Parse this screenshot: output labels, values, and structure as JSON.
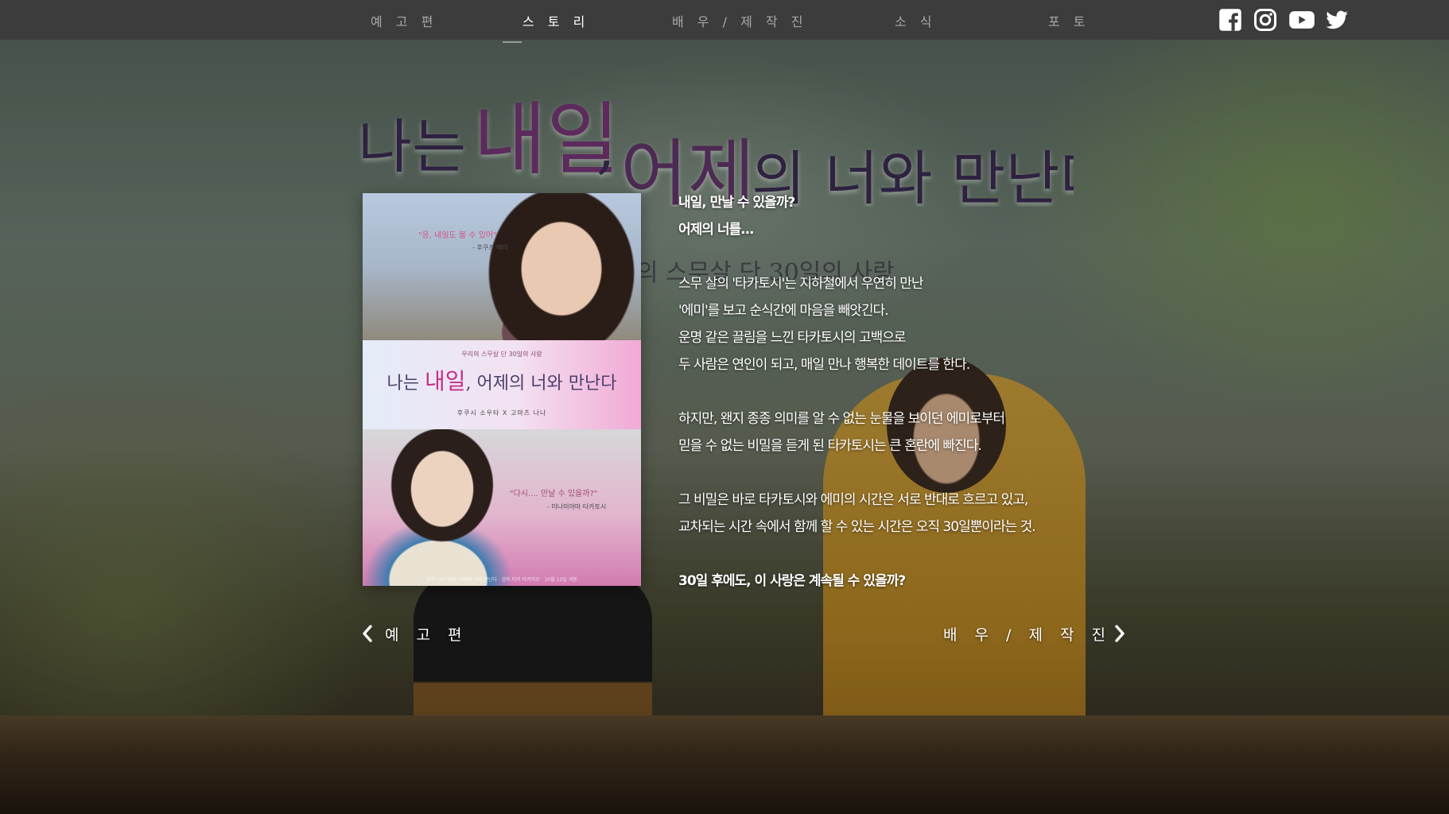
{
  "nav": {
    "items": [
      {
        "label": "예 고 편",
        "active": false
      },
      {
        "label": "스 토 리",
        "active": true
      },
      {
        "label": "배 우 / 제 작 진",
        "active": false
      },
      {
        "label": "소 식",
        "active": false
      },
      {
        "label": "포 토",
        "active": false
      }
    ],
    "social": [
      "facebook-icon",
      "instagram-icon",
      "youtube-icon",
      "twitter-icon"
    ]
  },
  "title": {
    "part1": "나는 ",
    "part2": "내일",
    "part3": ",",
    "part4": "어제",
    "part5": "의 너와 만난다",
    "ghost": "의 스무살 단 30일의 사랑"
  },
  "poster": {
    "quote_top": "\"응, 내일도 볼 수 있어\"",
    "credit_top": "- 후쿠즈 에미",
    "tagline": "우리의 스무살 단 30일의 사랑",
    "title_a": "나는 ",
    "title_b": "내일",
    "title_c": ", 어제의 너와 만난다",
    "cast": "후쿠시 소우타   X   고마츠 나나",
    "quote_bottom": "\"다시.... 만날 수 있을까?\"",
    "credit_bottom": "- 미나미야마 타카토시",
    "footer": "원작 나는 내일, 어제의 너와 만난다 · 감독 미키 타카히로 · 10월 12일 개봉"
  },
  "story": {
    "lines": [
      {
        "text": "내일, 만날 수 있을까?",
        "bold": true
      },
      {
        "text": "어제의 너를...",
        "bold": true
      },
      {
        "text": "",
        "bold": false
      },
      {
        "text": "스무 살의 '타카토시'는 지하철에서 우연히 만난",
        "bold": false
      },
      {
        "text": "'에미'를 보고 순식간에 마음을 빼앗긴다.",
        "bold": false
      },
      {
        "text": "운명 같은 끌림을 느낀 타카토시의 고백으로",
        "bold": false
      },
      {
        "text": "두 사람은 연인이 되고, 매일 만나 행복한 데이트를 한다.",
        "bold": false
      },
      {
        "text": "",
        "bold": false
      },
      {
        "text": "하지만, 왠지 종종 의미를 알 수 없는 눈물을 보이던 에미로부터",
        "bold": false
      },
      {
        "text": "믿을 수 없는 비밀을 듣게 된 타카토시는 큰 혼란에 빠진다.",
        "bold": false
      },
      {
        "text": "",
        "bold": false
      },
      {
        "text": "그 비밀은 바로 타카토시와 에미의 시간은 서로 반대로 흐르고 있고,",
        "bold": false
      },
      {
        "text": "교차되는 시간 속에서 함께 할 수 있는 시간은 오직 30일뿐이라는 것.",
        "bold": false
      },
      {
        "text": "",
        "bold": false
      },
      {
        "text": "30일 후에도, 이 사랑은 계속될 수 있을까?",
        "bold": true
      }
    ]
  },
  "bottom_nav": {
    "prev_label": "예 고 편",
    "next_label": "배 우 / 제 작 진"
  },
  "colors": {
    "nav_bg": "#3c3c3c",
    "title_dark": "#2e2440",
    "title_accent": "#5b2b5c",
    "poster_pink": "#c62e88"
  }
}
